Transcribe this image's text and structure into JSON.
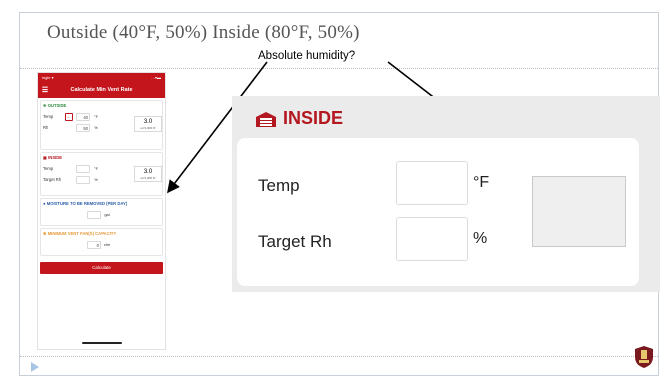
{
  "slide": {
    "title": "Outside (40°F, 50%) Inside (80°F, 50%)",
    "annotation": "Absolute humidity?"
  },
  "phone": {
    "status_left": "ingle ▾",
    "status_right": "…▾▬",
    "header_title": "Calculate Min Vent Rate",
    "outside": {
      "title": "❈ OUTSIDE",
      "temp_label": "Temp",
      "temp_value": "40",
      "temp_unit": "°F",
      "rh_label": "Rh",
      "rh_value": "50",
      "rh_unit": "%",
      "result_value": "3.0",
      "result_unit": "oz/1,000 ft³",
      "minus": "−"
    },
    "inside": {
      "title": "INSIDE",
      "temp_label": "Temp",
      "temp_unit": "°F",
      "rh_label": "Target Rh",
      "rh_unit": "%",
      "result_value": "3.0",
      "result_unit": "oz/1,000 ft³"
    },
    "moisture": {
      "title": "MOISTURE TO BE REMOVED (PER DAY)",
      "unit": "gal"
    },
    "vent": {
      "title": "MINIMUM VENT FAN(S) CAPACITY",
      "value": "0",
      "unit": "cfm"
    },
    "calculate_label": "Calculate"
  },
  "zoom": {
    "title": "INSIDE",
    "temp_label": "Temp",
    "temp_unit": "°F",
    "rh_label": "Target Rh",
    "rh_unit": "%"
  },
  "colors": {
    "brand_red": "#c4151c",
    "outside_green": "#2e8b3a",
    "moisture_blue": "#2a5ea8",
    "vent_orange": "#e69a3a"
  },
  "icons": [
    "menu-icon",
    "sun-icon",
    "garage-icon",
    "droplet-icon",
    "fan-icon",
    "play-icon",
    "university-seal-icon"
  ]
}
